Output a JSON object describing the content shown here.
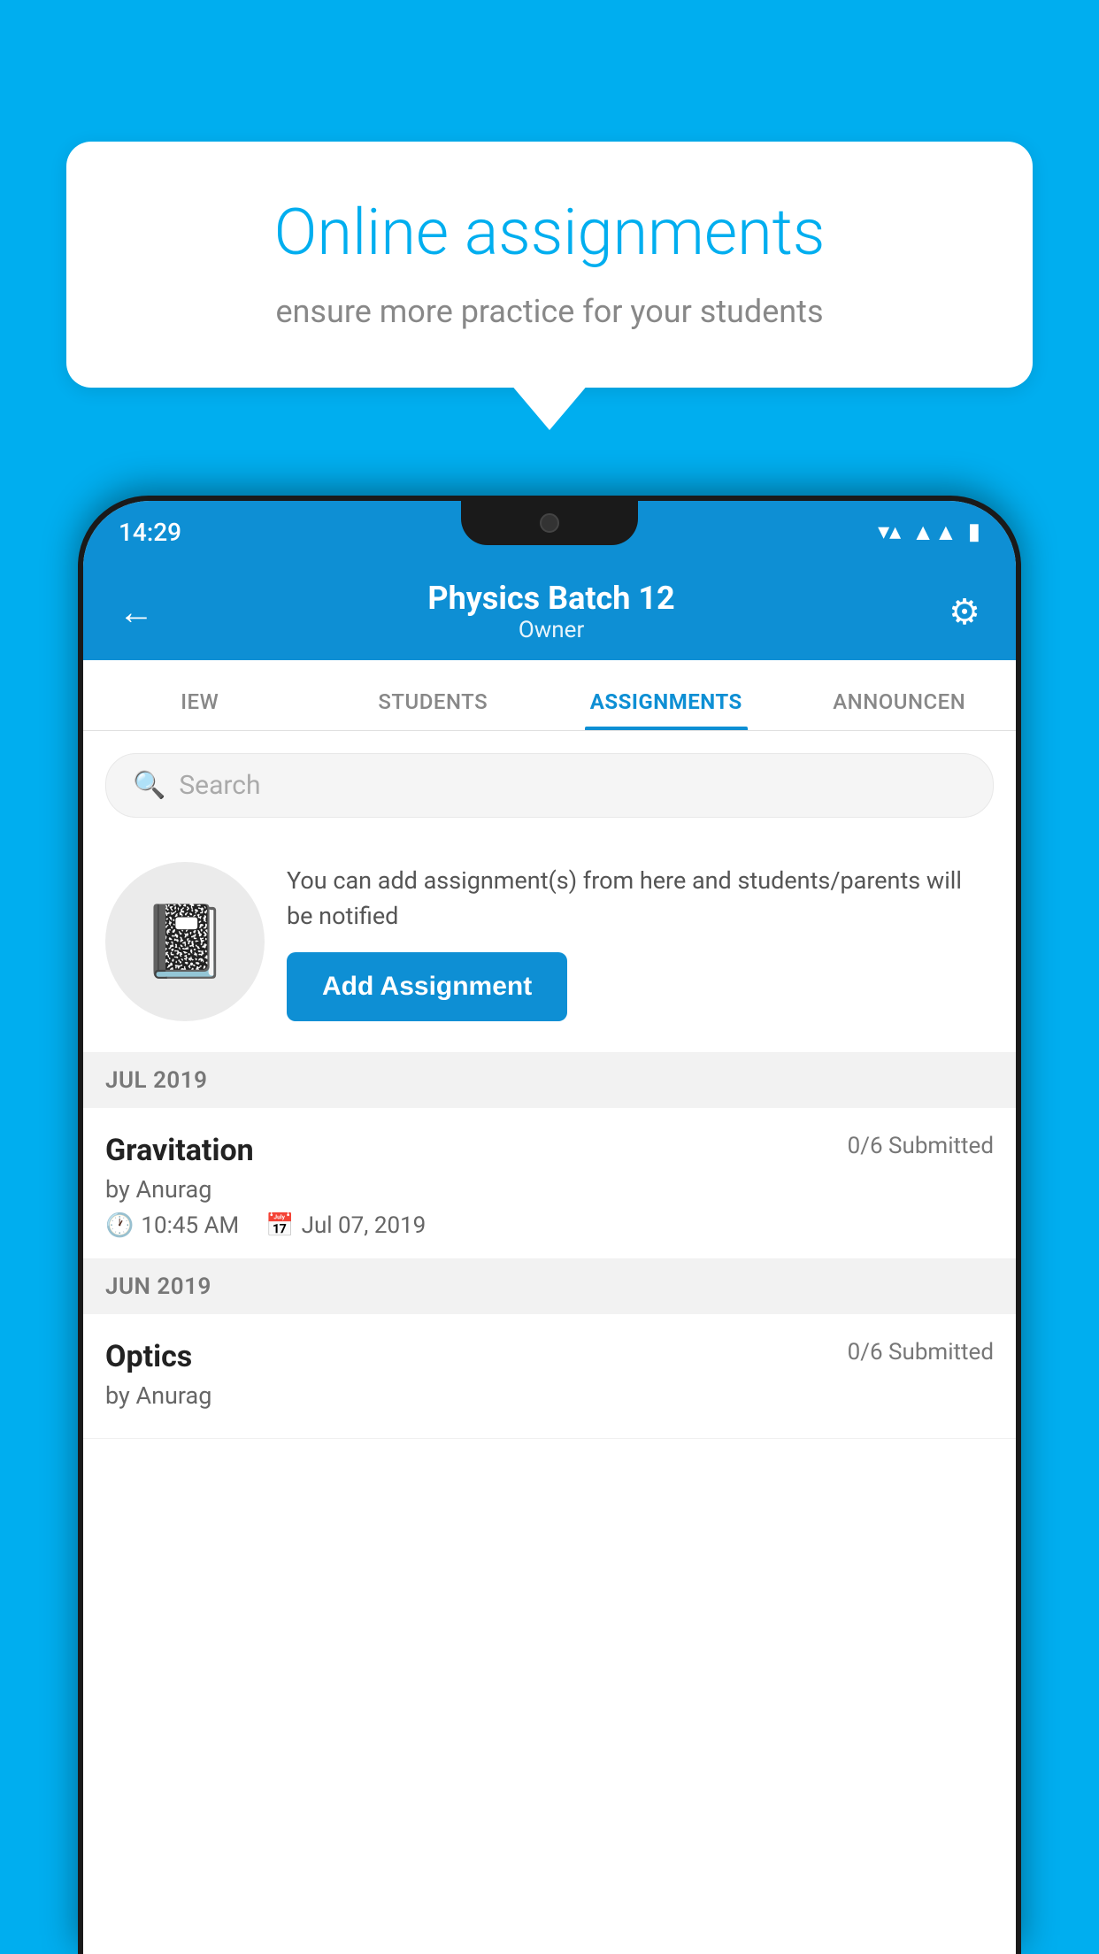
{
  "background_color": "#00AEEF",
  "promo": {
    "title": "Online assignments",
    "subtitle": "ensure more practice for your students"
  },
  "status_bar": {
    "time": "14:29",
    "wifi_icon": "▼",
    "signal_icon": "◀",
    "battery_icon": "▮"
  },
  "header": {
    "title": "Physics Batch 12",
    "subtitle": "Owner",
    "back_label": "←",
    "gear_label": "⚙"
  },
  "tabs": [
    {
      "id": "iew",
      "label": "IEW",
      "active": false
    },
    {
      "id": "students",
      "label": "STUDENTS",
      "active": false
    },
    {
      "id": "assignments",
      "label": "ASSIGNMENTS",
      "active": true
    },
    {
      "id": "announcements",
      "label": "ANNOUNCEN",
      "active": false
    }
  ],
  "search": {
    "placeholder": "Search"
  },
  "cta": {
    "description": "You can add assignment(s) from here and students/parents will be notified",
    "button_label": "Add Assignment"
  },
  "sections": [
    {
      "label": "JUL 2019",
      "assignments": [
        {
          "name": "Gravitation",
          "submitted": "0/6 Submitted",
          "author": "by Anurag",
          "time": "10:45 AM",
          "date": "Jul 07, 2019"
        }
      ]
    },
    {
      "label": "JUN 2019",
      "assignments": [
        {
          "name": "Optics",
          "submitted": "0/6 Submitted",
          "author": "by Anurag",
          "time": "",
          "date": ""
        }
      ]
    }
  ]
}
